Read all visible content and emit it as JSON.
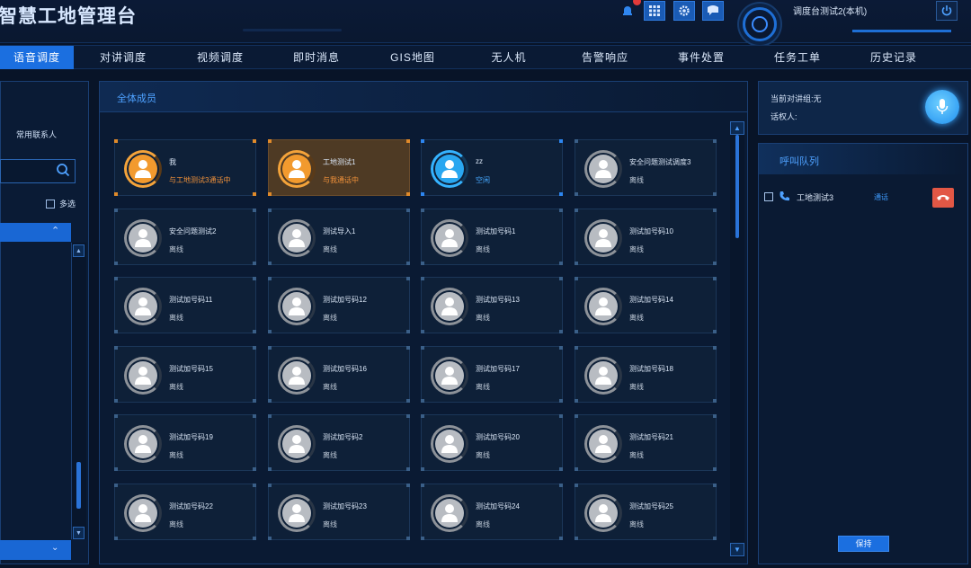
{
  "header": {
    "title": "智慧工地管理台",
    "user_info": "调度台测试2(本机)"
  },
  "nav": {
    "tabs": [
      "语音调度",
      "对讲调度",
      "视频调度",
      "即时消息",
      "GIS地图",
      "无人机",
      "告警响应",
      "事件处置",
      "任务工单",
      "历史记录"
    ],
    "active_index": 0
  },
  "left_panel": {
    "contacts_label": "常用联系人",
    "multi_select_label": "多选"
  },
  "center_panel": {
    "title": "全体成员",
    "members": [
      {
        "name": "我",
        "status": "与工地测试3通话中",
        "variant": "orange"
      },
      {
        "name": "工地测试1",
        "status": "与我通话中",
        "variant": "orange-fill"
      },
      {
        "name": "zz",
        "status": "空闲",
        "variant": "blue"
      },
      {
        "name": "安全问题测试调度3",
        "status": "离线",
        "variant": "gray"
      },
      {
        "name": "安全问题测试2",
        "status": "离线",
        "variant": "gray"
      },
      {
        "name": "测试导入1",
        "status": "离线",
        "variant": "gray"
      },
      {
        "name": "测试加号码1",
        "status": "离线",
        "variant": "gray"
      },
      {
        "name": "测试加号码10",
        "status": "离线",
        "variant": "gray"
      },
      {
        "name": "测试加号码11",
        "status": "离线",
        "variant": "gray"
      },
      {
        "name": "测试加号码12",
        "status": "离线",
        "variant": "gray"
      },
      {
        "name": "测试加号码13",
        "status": "离线",
        "variant": "gray"
      },
      {
        "name": "测试加号码14",
        "status": "离线",
        "variant": "gray"
      },
      {
        "name": "测试加号码15",
        "status": "离线",
        "variant": "gray"
      },
      {
        "name": "测试加号码16",
        "status": "离线",
        "variant": "gray"
      },
      {
        "name": "测试加号码17",
        "status": "离线",
        "variant": "gray"
      },
      {
        "name": "测试加号码18",
        "status": "离线",
        "variant": "gray"
      },
      {
        "name": "测试加号码19",
        "status": "离线",
        "variant": "gray"
      },
      {
        "name": "测试加号码2",
        "status": "离线",
        "variant": "gray"
      },
      {
        "name": "测试加号码20",
        "status": "离线",
        "variant": "gray"
      },
      {
        "name": "测试加号码21",
        "status": "离线",
        "variant": "gray"
      },
      {
        "name": "测试加号码22",
        "status": "离线",
        "variant": "gray"
      },
      {
        "name": "测试加号码23",
        "status": "离线",
        "variant": "gray"
      },
      {
        "name": "测试加号码24",
        "status": "离线",
        "variant": "gray"
      },
      {
        "name": "测试加号码25",
        "status": "离线",
        "variant": "gray"
      }
    ]
  },
  "right_panel": {
    "current_group_label": "当前对讲组:无",
    "speaker_label": "话权人:",
    "queue_title": "呼叫队列",
    "queue": [
      {
        "name": "工地测试3",
        "status": "通话"
      }
    ],
    "hold_button": "保持"
  },
  "colors": {
    "accent": "#1b6fe0",
    "background": "#081428",
    "busy": "#f0913a",
    "online": "#45a8ff",
    "hangup": "#e25745"
  }
}
